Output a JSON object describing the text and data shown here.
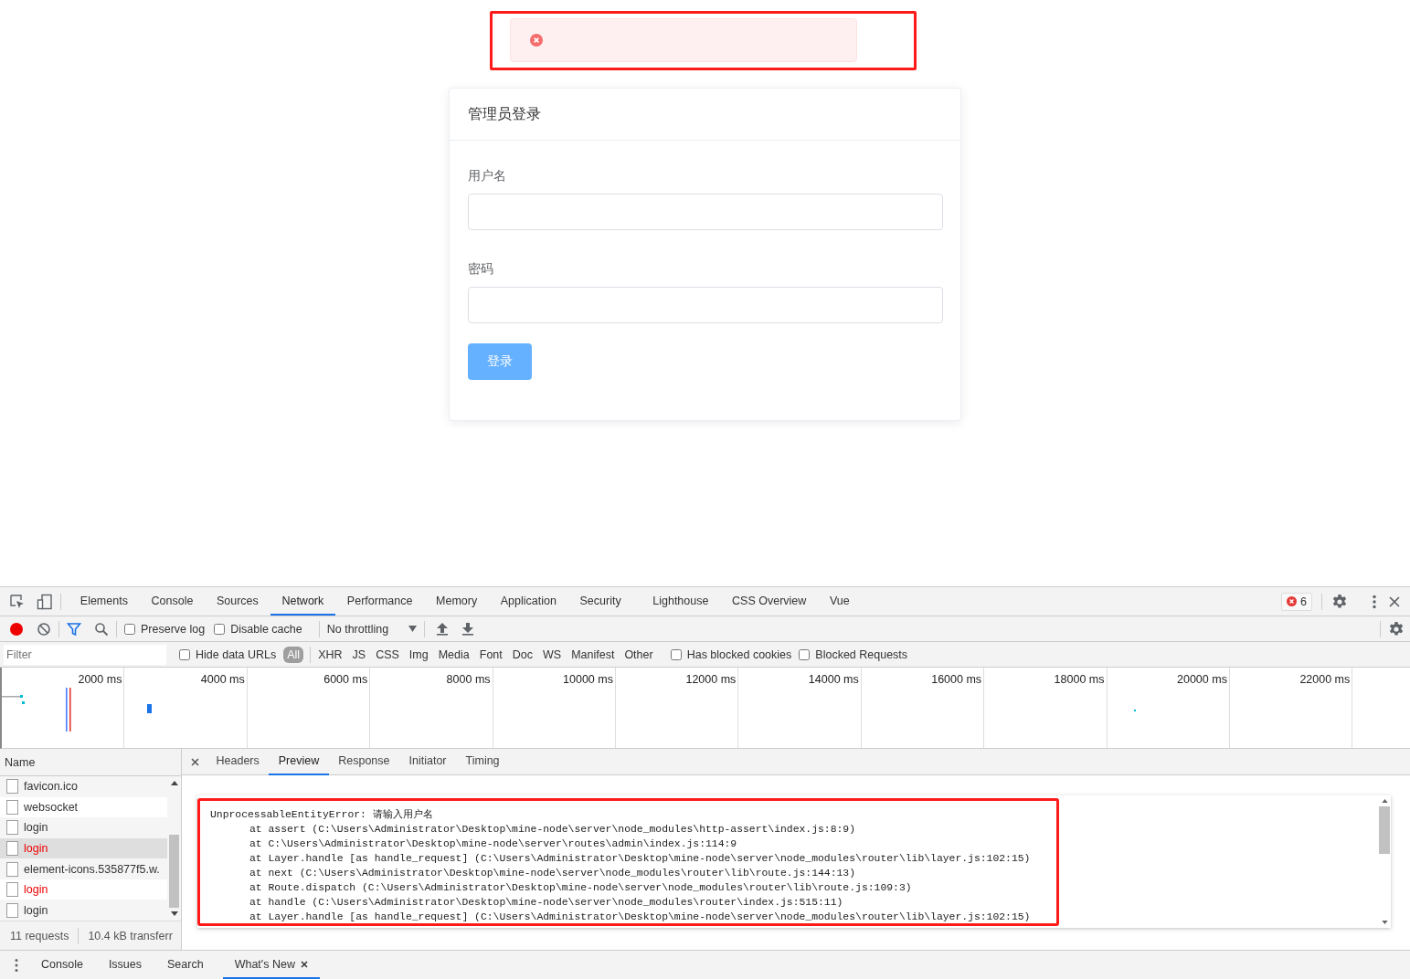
{
  "toast": {
    "highlighted": true
  },
  "login_card": {
    "title": "管理员登录",
    "fields": [
      {
        "label": "用户名"
      },
      {
        "label": "密码"
      }
    ],
    "submit": "登录"
  },
  "devtools": {
    "main_tabs": [
      {
        "label": "Elements",
        "selected": false
      },
      {
        "label": "Console",
        "selected": false
      },
      {
        "label": "Sources",
        "selected": false
      },
      {
        "label": "Network",
        "selected": true
      },
      {
        "label": "Performance",
        "selected": false
      },
      {
        "label": "Memory",
        "selected": false
      },
      {
        "label": "Application",
        "selected": false
      },
      {
        "label": "Security",
        "selected": false
      },
      {
        "label": "Lighthouse",
        "selected": false
      },
      {
        "label": "CSS Overview",
        "selected": false
      },
      {
        "label": "Vue",
        "selected": false
      }
    ],
    "error_count": "6",
    "toolbar": {
      "recording": true,
      "filter_active": true,
      "options": [
        {
          "label": "Preserve log",
          "checked": false
        },
        {
          "label": "Disable cache",
          "checked": false
        }
      ],
      "throttling": "No throttling"
    },
    "filter_bar": {
      "placeholder": "Filter",
      "hide_data_urls": {
        "label": "Hide data URLs",
        "checked": false
      },
      "types": [
        {
          "label": "All",
          "selected": true
        },
        {
          "label": "XHR",
          "selected": false
        },
        {
          "label": "JS",
          "selected": false
        },
        {
          "label": "CSS",
          "selected": false
        },
        {
          "label": "Img",
          "selected": false
        },
        {
          "label": "Media",
          "selected": false
        },
        {
          "label": "Font",
          "selected": false
        },
        {
          "label": "Doc",
          "selected": false
        },
        {
          "label": "WS",
          "selected": false
        },
        {
          "label": "Manifest",
          "selected": false
        },
        {
          "label": "Other",
          "selected": false
        }
      ],
      "extra_options": [
        {
          "label": "Has blocked cookies",
          "checked": false
        },
        {
          "label": "Blocked Requests",
          "checked": false
        }
      ]
    },
    "timeline_ticks": [
      "2000 ms",
      "4000 ms",
      "6000 ms",
      "8000 ms",
      "10000 ms",
      "12000 ms",
      "14000 ms",
      "16000 ms",
      "18000 ms",
      "20000 ms",
      "22000 ms"
    ],
    "requests_header": "Name",
    "requests": [
      {
        "name": "favicon.ico",
        "failed": false,
        "selected": false
      },
      {
        "name": "websocket",
        "failed": false,
        "selected": false
      },
      {
        "name": "login",
        "failed": false,
        "selected": false
      },
      {
        "name": "login",
        "failed": true,
        "selected": true
      },
      {
        "name": "element-icons.535877f5.w.",
        "failed": false,
        "selected": false
      },
      {
        "name": "login",
        "failed": true,
        "selected": false
      },
      {
        "name": "login",
        "failed": false,
        "selected": false
      }
    ],
    "summary": [
      "11 requests",
      "10.4 kB transferr"
    ],
    "detail_tabs": [
      {
        "label": "Headers",
        "selected": false
      },
      {
        "label": "Preview",
        "selected": true
      },
      {
        "label": "Response",
        "selected": false
      },
      {
        "label": "Initiator",
        "selected": false
      },
      {
        "label": "Timing",
        "selected": false
      }
    ],
    "preview": {
      "highlighted": true,
      "lines": [
        "UnprocessableEntityError: 请输入用户名",
        "at assert (C:\\Users\\Administrator\\Desktop\\mine-node\\server\\node_modules\\http-assert\\index.js:8:9)",
        "at C:\\Users\\Administrator\\Desktop\\mine-node\\server\\routes\\admin\\index.js:114:9",
        "at Layer.handle [as handle_request] (C:\\Users\\Administrator\\Desktop\\mine-node\\server\\node_modules\\router\\lib\\layer.js:102:15)",
        "at next (C:\\Users\\Administrator\\Desktop\\mine-node\\server\\node_modules\\router\\lib\\route.js:144:13)",
        "at Route.dispatch (C:\\Users\\Administrator\\Desktop\\mine-node\\server\\node_modules\\router\\lib\\route.js:109:3)",
        "at handle (C:\\Users\\Administrator\\Desktop\\mine-node\\server\\node_modules\\router\\index.js:515:11)",
        "at Layer.handle [as handle_request] (C:\\Users\\Administrator\\Desktop\\mine-node\\server\\node_modules\\router\\lib\\layer.js:102:15)"
      ]
    },
    "drawer_tabs": [
      {
        "label": "Console",
        "selected": false,
        "closable": false
      },
      {
        "label": "Issues",
        "selected": false,
        "closable": false
      },
      {
        "label": "Search",
        "selected": false,
        "closable": false
      },
      {
        "label": "What's New",
        "selected": true,
        "closable": true
      }
    ]
  }
}
